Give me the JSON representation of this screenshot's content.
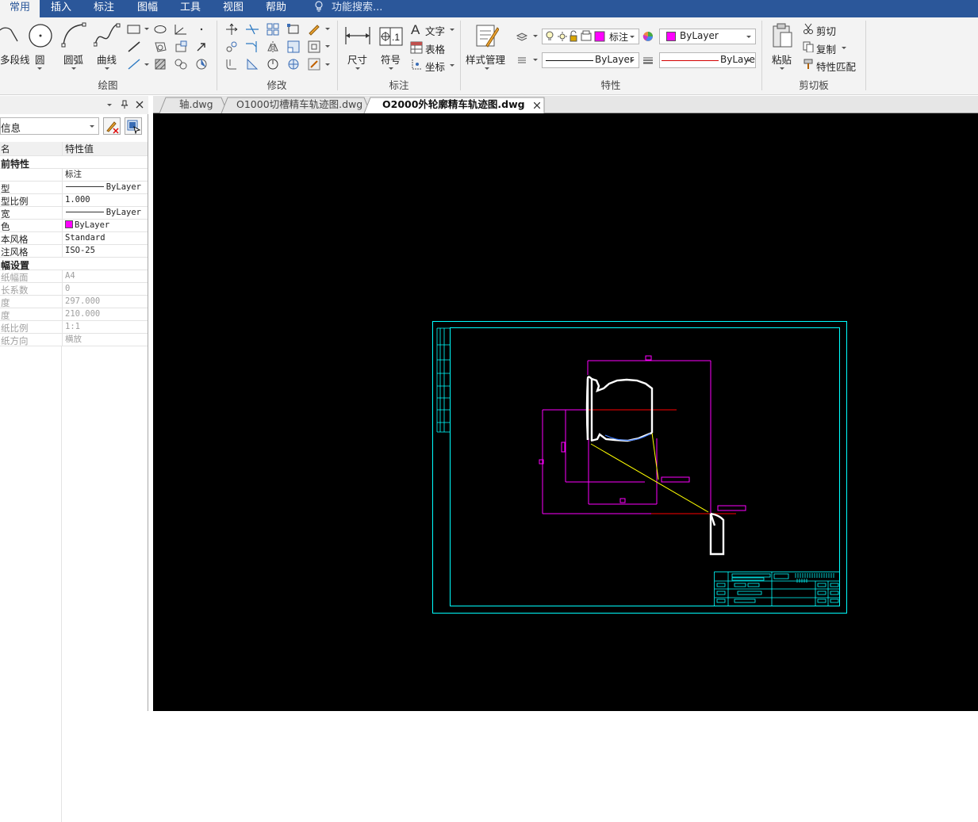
{
  "menubar": {
    "tabs": [
      "常用",
      "插入",
      "标注",
      "图幅",
      "工具",
      "视图",
      "帮助"
    ],
    "active_tab": "常用",
    "search_placeholder": "功能搜索..."
  },
  "ribbon": {
    "draw": {
      "title": "绘图",
      "polyline_label": "多段线",
      "circle_label": "圆",
      "arc_label": "圆弧",
      "curve_label": "曲线"
    },
    "modify": {
      "title": "修改"
    },
    "annotate": {
      "title": "标注",
      "dimension_label": "尺寸",
      "symbol_label": "符号",
      "text_label": "文字",
      "table_label": "表格",
      "coord_label": "坐标"
    },
    "properties": {
      "title": "特性",
      "style_manager_label": "样式管理",
      "layer_value": "标注",
      "color_value": "ByLayer",
      "linetype_value": "ByLayer",
      "lineweight_value": "ByLayer",
      "color_swatch": "#ff00ff"
    },
    "clipboard": {
      "title": "剪切板",
      "paste_label": "粘贴",
      "cut_label": "剪切",
      "copy_label": "复制",
      "match_label": "特性匹配"
    }
  },
  "doc_tabs": [
    "轴.dwg",
    "O1000切槽精车轨迹图.dwg",
    "O2000外轮廓精车轨迹图.dwg"
  ],
  "active_doc_tab": "O2000外轮廓精车轨迹图.dwg",
  "panel": {
    "selector_value": "信息",
    "header_name": "名",
    "header_value": "特性值",
    "rows": [
      {
        "kind": "cat",
        "name": "前特性",
        "value": ""
      },
      {
        "kind": "row",
        "name": "",
        "value": "标注"
      },
      {
        "kind": "row",
        "name": "型",
        "value": "ByLayer",
        "line": true
      },
      {
        "kind": "row",
        "name": "型比例",
        "value": "1.000"
      },
      {
        "kind": "row",
        "name": "宽",
        "value": "ByLayer",
        "line": true
      },
      {
        "kind": "row",
        "name": "色",
        "value": "ByLayer",
        "swatch": "#ff00ff"
      },
      {
        "kind": "row",
        "name": "本风格",
        "value": "Standard"
      },
      {
        "kind": "row",
        "name": "注风格",
        "value": "ISO-25"
      },
      {
        "kind": "cat",
        "name": "幅设置",
        "value": ""
      },
      {
        "kind": "dim",
        "name": "纸幅面",
        "value": "A4"
      },
      {
        "kind": "dim",
        "name": "长系数",
        "value": "0"
      },
      {
        "kind": "dim",
        "name": "度",
        "value": "297.000"
      },
      {
        "kind": "dim",
        "name": "度",
        "value": "210.000"
      },
      {
        "kind": "dim",
        "name": "纸比例",
        "value": "1:1"
      },
      {
        "kind": "dim",
        "name": "纸方向",
        "value": "横放"
      }
    ]
  },
  "colors": {
    "menubar": "#2b579a",
    "canvas_bg": "#000000",
    "frame": "#00ffff",
    "dimension": "#ff00ff",
    "profile": "#ffffff",
    "toolpath": "#ffff00",
    "centerline": "#ff0000"
  }
}
